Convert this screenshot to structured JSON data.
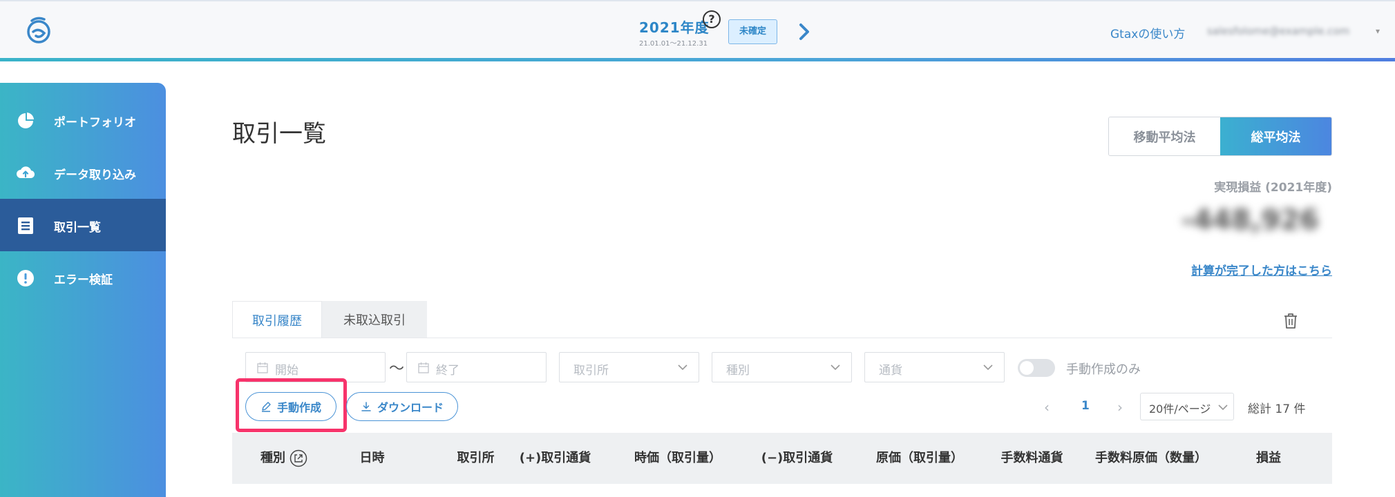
{
  "header": {
    "fiscal_year": "2021年度",
    "period": "21.01.01〜21.12.31",
    "help_symbol": "?",
    "status_badge": "未確定",
    "howto_link": "Gtaxの使い方",
    "account_email": "salesfolome@example.com",
    "account_caret": "▾"
  },
  "sidebar": {
    "items": [
      {
        "label": "ポートフォリオ",
        "icon": "pie-chart-icon"
      },
      {
        "label": "データ取り込み",
        "icon": "cloud-upload-icon"
      },
      {
        "label": "取引一覧",
        "icon": "document-list-icon",
        "active": true
      },
      {
        "label": "エラー検証",
        "icon": "warning-icon"
      }
    ]
  },
  "main": {
    "title": "取引一覧",
    "methods": {
      "moving_avg": "移動平均法",
      "total_avg": "総平均法",
      "selected": "総平均法"
    },
    "realized_label": "実現損益 (2021年度)",
    "realized_value": "-448,926",
    "calc_link": "計算が完了した方はこちら"
  },
  "tabs": [
    {
      "label": "取引履歴",
      "active": true
    },
    {
      "label": "未取込取引",
      "active": false
    }
  ],
  "filters": {
    "start_placeholder": "開始",
    "range_separator": "〜",
    "end_placeholder": "終了",
    "exchange_placeholder": "取引所",
    "type_placeholder": "種別",
    "currency_placeholder": "通貨",
    "manual_only_label": "手動作成のみ",
    "manual_only": false
  },
  "actions": {
    "manual_create": "手動作成",
    "download": "ダウンロード"
  },
  "pagination": {
    "prev": "‹",
    "current_page": "1",
    "next": "›",
    "per_page": "20件/ページ",
    "total": "総計 17 件"
  },
  "table": {
    "columns": [
      "種別",
      "日時",
      "取引所",
      "(+)取引通貨",
      "時価（取引量）",
      "(−)取引通貨",
      "原価（取引量）",
      "手数料通貨",
      "手数料原価（数量）",
      "損益"
    ]
  },
  "colors": {
    "accent": "#3a87c9",
    "sidebar_start": "#3bb5c6",
    "sidebar_end": "#4c8fe0",
    "highlight": "#f7336b"
  }
}
